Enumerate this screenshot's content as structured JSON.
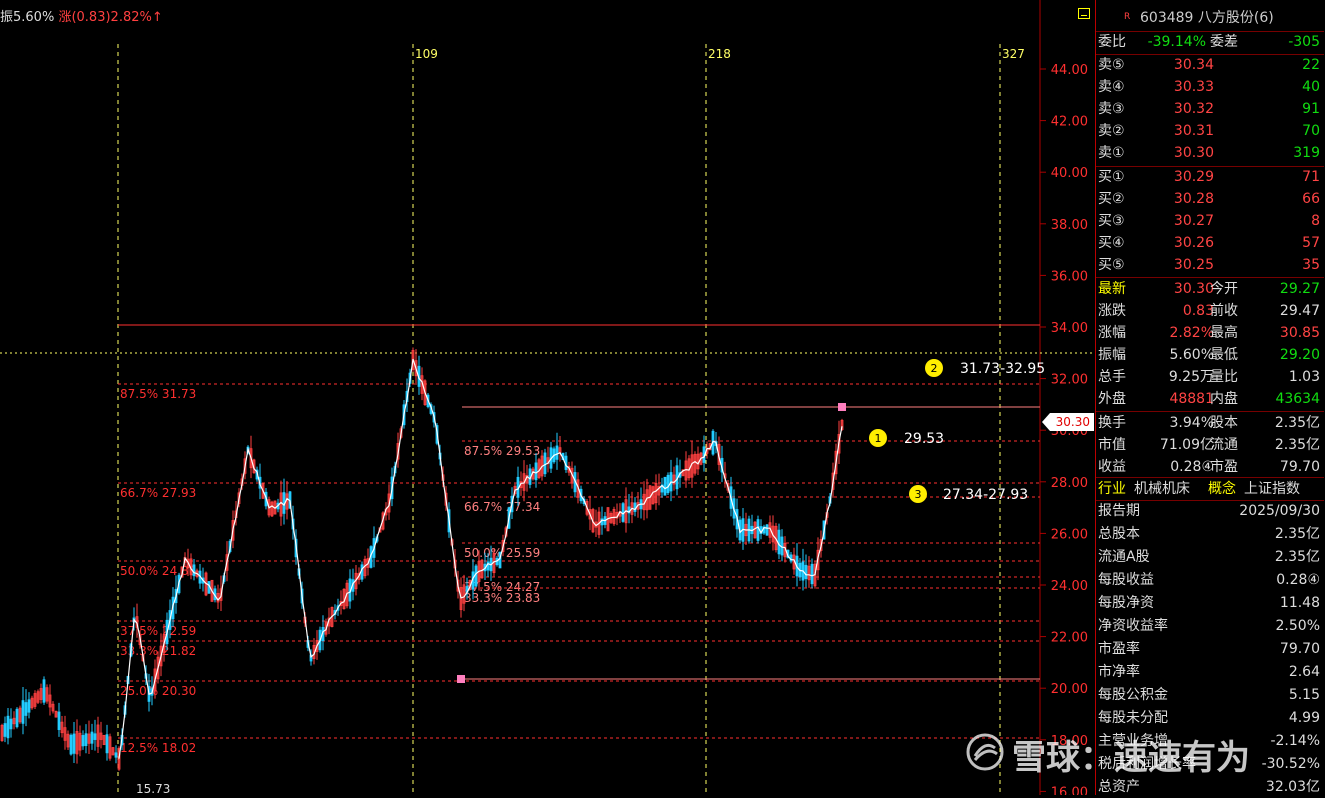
{
  "top_info": {
    "amplitude": "振5.60%",
    "change": "涨(0.83)2.82%↑"
  },
  "chart": {
    "y_labels": [
      "44.00",
      "42.00",
      "40.00",
      "38.00",
      "36.00",
      "34.00",
      "32.00",
      "30.00",
      "28.00",
      "26.00",
      "24.00",
      "22.00",
      "20.00",
      "18.00",
      "16.00"
    ],
    "vline_labels": [
      "109",
      "218",
      "327"
    ],
    "low_label": "15.73",
    "fib_left": [
      "87.5% 31.73",
      "66.7% 27.93",
      "50.0% 24.86",
      "37.5% 22.59",
      "33.3% 21.82",
      "25.0% 20.30",
      "12.5% 18.02"
    ],
    "fib_mid": [
      "87.5% 29.53",
      "66.7% 27.34",
      "50.0% 25.59",
      "37.5% 24.27",
      "33.3% 23.83"
    ],
    "targets": [
      {
        "num": "1",
        "text": "29.53"
      },
      {
        "num": "2",
        "text": "31.73-32.95"
      },
      {
        "num": "3",
        "text": "27.34-27.93"
      }
    ],
    "current_price": "30.30",
    "colors": {
      "up": "#ff4040",
      "down": "#22ccff",
      "ma": "#ffffff",
      "fib": "#ff3030",
      "vline": "#ffff66"
    }
  },
  "panel": {
    "r_mark": "R",
    "code_name": "603489 八方股份(6)",
    "weibi": {
      "l1": "委比",
      "v1": "-39.14%",
      "l2": "委差",
      "v2": "-305"
    },
    "sells": [
      {
        "label": "卖⑤",
        "price": "30.34",
        "vol": "22"
      },
      {
        "label": "卖④",
        "price": "30.33",
        "vol": "40"
      },
      {
        "label": "卖③",
        "price": "30.32",
        "vol": "91"
      },
      {
        "label": "卖②",
        "price": "30.31",
        "vol": "70"
      },
      {
        "label": "卖①",
        "price": "30.30",
        "vol": "319"
      }
    ],
    "buys": [
      {
        "label": "买①",
        "price": "30.29",
        "vol": "71"
      },
      {
        "label": "买②",
        "price": "30.28",
        "vol": "66"
      },
      {
        "label": "买③",
        "price": "30.27",
        "vol": "8"
      },
      {
        "label": "买④",
        "price": "30.26",
        "vol": "57"
      },
      {
        "label": "买⑤",
        "price": "30.25",
        "vol": "35"
      }
    ],
    "quote": [
      {
        "l1": "最新",
        "v1": "30.30",
        "c1": "r",
        "l2": "今开",
        "v2": "29.27",
        "c2": "g"
      },
      {
        "l1": "涨跌",
        "v1": "0.83",
        "c1": "r",
        "l2": "前收",
        "v2": "29.47",
        "c2": "w"
      },
      {
        "l1": "涨幅",
        "v1": "2.82%",
        "c1": "r",
        "l2": "最高",
        "v2": "30.85",
        "c2": "r"
      },
      {
        "l1": "振幅",
        "v1": "5.60%",
        "c1": "w",
        "l2": "最低",
        "v2": "29.20",
        "c2": "g"
      },
      {
        "l1": "总手",
        "v1": "9.25万",
        "c1": "w",
        "l2": "量比",
        "v2": "1.03",
        "c2": "w"
      },
      {
        "l1": "外盘",
        "v1": "48881",
        "c1": "r",
        "l2": "内盘",
        "v2": "43634",
        "c2": "g"
      }
    ],
    "stats": [
      {
        "l1": "换手",
        "v1": "3.94%",
        "l2": "股本",
        "v2": "2.35亿"
      },
      {
        "l1": "市值",
        "v1": "71.09亿",
        "l2": "流通",
        "v2": "2.35亿"
      },
      {
        "l1": "收益",
        "v1": "0.28④",
        "l2": "市盈",
        "v2": "79.70"
      }
    ],
    "industry": {
      "l1": "行业",
      "v1": "机械机床",
      "l2": "概念",
      "v2": "上证指数"
    },
    "finance": [
      {
        "l": "报告期",
        "v": "2025/09/30"
      },
      {
        "l": "总股本",
        "v": "2.35亿"
      },
      {
        "l": "流通A股",
        "v": "2.35亿"
      },
      {
        "l": "每股收益",
        "v": "0.28④"
      },
      {
        "l": "每股净资",
        "v": "11.48"
      },
      {
        "l": "净资收益率",
        "v": "2.50%"
      },
      {
        "l": "市盈率",
        "v": "79.70"
      },
      {
        "l": "市净率",
        "v": "2.64"
      },
      {
        "l": "每股公积金",
        "v": "5.15"
      },
      {
        "l": "每股未分配",
        "v": "4.99"
      },
      {
        "l": "主营业务增",
        "v": "-2.14%"
      },
      {
        "l": "税后利润增长率",
        "v": "-30.52%"
      },
      {
        "l": "总资产",
        "v": "32.03亿"
      }
    ]
  },
  "watermark": "雪球：速速有为"
}
